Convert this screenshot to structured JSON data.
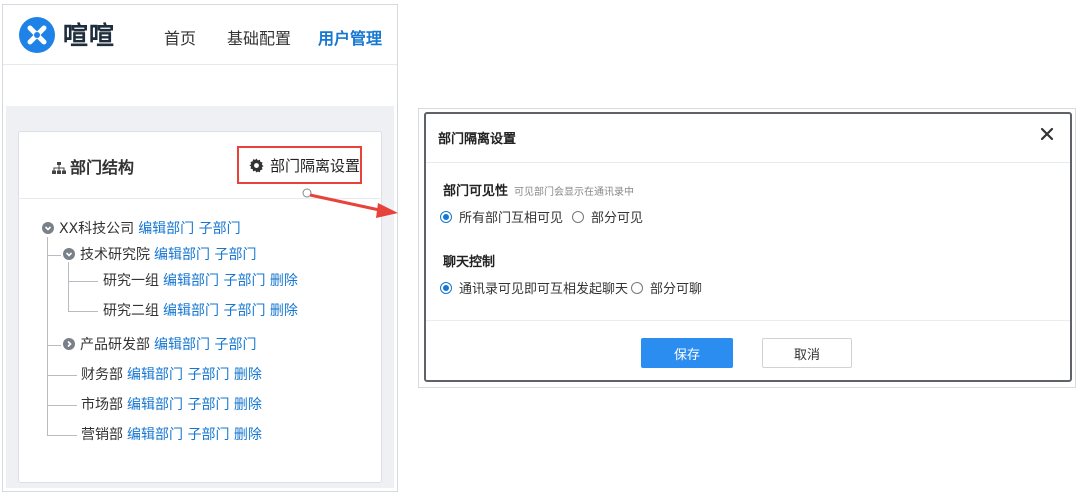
{
  "app": {
    "name": "喧喧"
  },
  "nav": [
    {
      "label": "首页",
      "active": false
    },
    {
      "label": "基础配置",
      "active": false
    },
    {
      "label": "用户管理",
      "active": true
    }
  ],
  "org_panel": {
    "title": "部门结构",
    "isolation_button": "部门隔离设置"
  },
  "tree": {
    "root": {
      "name": "XX科技公司",
      "edit": "编辑部门",
      "child": "子部门"
    },
    "tech": {
      "name": "技术研究院",
      "edit": "编辑部门",
      "child": "子部门"
    },
    "rd1": {
      "name": "研究一组",
      "edit": "编辑部门",
      "child": "子部门",
      "delete": "删除"
    },
    "rd2": {
      "name": "研究二组",
      "edit": "编辑部门",
      "child": "子部门",
      "delete": "删除"
    },
    "product": {
      "name": "产品研发部",
      "edit": "编辑部门",
      "child": "子部门"
    },
    "finance": {
      "name": "财务部",
      "edit": "编辑部门",
      "child": "子部门",
      "delete": "删除"
    },
    "market": {
      "name": "市场部",
      "edit": "编辑部门",
      "child": "子部门",
      "delete": "删除"
    },
    "sales": {
      "name": "营销部",
      "edit": "编辑部门",
      "child": "子部门",
      "delete": "删除"
    }
  },
  "modal": {
    "title": "部门隔离设置",
    "visibility": {
      "title": "部门可见性",
      "hint": "可见部门会显示在通讯录中",
      "options": [
        "所有部门互相可见",
        "部分可见"
      ],
      "selected": 0
    },
    "chat": {
      "title": "聊天控制",
      "options": [
        "通讯录可见即可互相发起聊天",
        "部分可聊"
      ],
      "selected": 0
    },
    "save": "保存",
    "cancel": "取消"
  },
  "colors": {
    "accent": "#1677d2",
    "primary_button": "#2c8df0",
    "highlight": "#e8433b"
  }
}
